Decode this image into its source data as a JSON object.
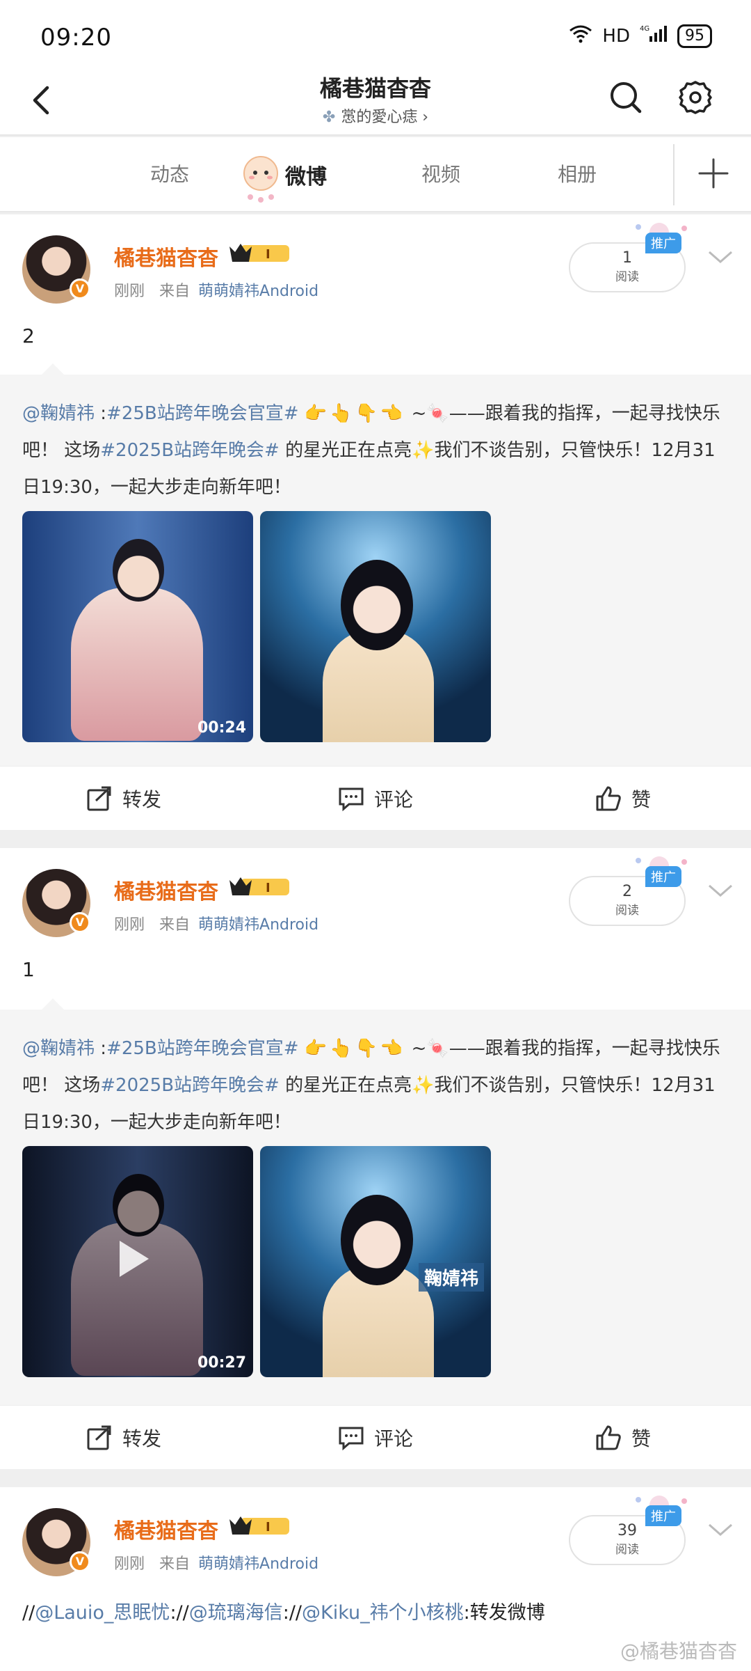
{
  "status_bar": {
    "time": "09:20",
    "network": "HD",
    "signal": "4G",
    "battery": "95"
  },
  "nav": {
    "title": "橘巷猫杳杳",
    "subtitle": "㦂的愛心痣 ›"
  },
  "tabs": [
    {
      "label": "动态"
    },
    {
      "label": "微博"
    },
    {
      "label": "视频"
    },
    {
      "label": "相册"
    }
  ],
  "active_tab": "微博",
  "posts": [
    {
      "username": "橘巷猫杳杳",
      "level": "I",
      "time": "刚刚",
      "from_label": "来自",
      "source": "萌萌婧祎Android",
      "read_count": "1",
      "read_label": "阅读",
      "promo": "推广",
      "text": "2",
      "repost": {
        "mention": "@鞠婧祎",
        "sep": " :",
        "tag1": "#25B站跨年晚会官宣#",
        "emojis": "👉👆👇👈",
        "tilde": " ~🍬——跟着我的指挥，一起寻找快乐吧！ 这场",
        "tag2": "#2025B站跨年晚会#",
        "rest": " 的星光正在点亮✨我们不谈告别，只管快乐！12月31日19:30，一起大步走向新年吧！"
      },
      "media": [
        {
          "duration": "00:24"
        },
        {
          "duration": ""
        }
      ],
      "actions": {
        "repost": "转发",
        "comment": "评论",
        "like": "赞"
      }
    },
    {
      "username": "橘巷猫杳杳",
      "level": "I",
      "time": "刚刚",
      "from_label": "来自",
      "source": "萌萌婧祎Android",
      "read_count": "2",
      "read_label": "阅读",
      "promo": "推广",
      "text": "1",
      "repost": {
        "mention": "@鞠婧祎",
        "sep": " :",
        "tag1": "#25B站跨年晚会官宣#",
        "emojis": "👉👆👇👈",
        "tilde": " ~🍬——跟着我的指挥，一起寻找快乐吧！ 这场",
        "tag2": "#2025B站跨年晚会#",
        "rest": " 的星光正在点亮✨我们不谈告别，只管快乐！12月31日19:30，一起大步走向新年吧！"
      },
      "media": [
        {
          "duration": "00:27"
        },
        {
          "duration": "",
          "tag": "鞠婧祎"
        }
      ],
      "actions": {
        "repost": "转发",
        "comment": "评论",
        "like": "赞"
      }
    },
    {
      "username": "橘巷猫杳杳",
      "level": "I",
      "time": "刚刚",
      "from_label": "来自",
      "source": "萌萌婧祎Android",
      "read_count": "39",
      "read_label": "阅读",
      "promo": "推广",
      "text_parts": [
        {
          "t": "//",
          "link": false
        },
        {
          "t": "@Lauio_思眠忧",
          "link": true
        },
        {
          "t": "://",
          "link": false
        },
        {
          "t": "@琉璃海信",
          "link": true
        },
        {
          "t": "://",
          "link": false
        },
        {
          "t": "@Kiku_祎个小核桃",
          "link": true
        },
        {
          "t": ":转发微博",
          "link": false
        }
      ]
    }
  ],
  "watermark": "@橘巷猫杳杳"
}
